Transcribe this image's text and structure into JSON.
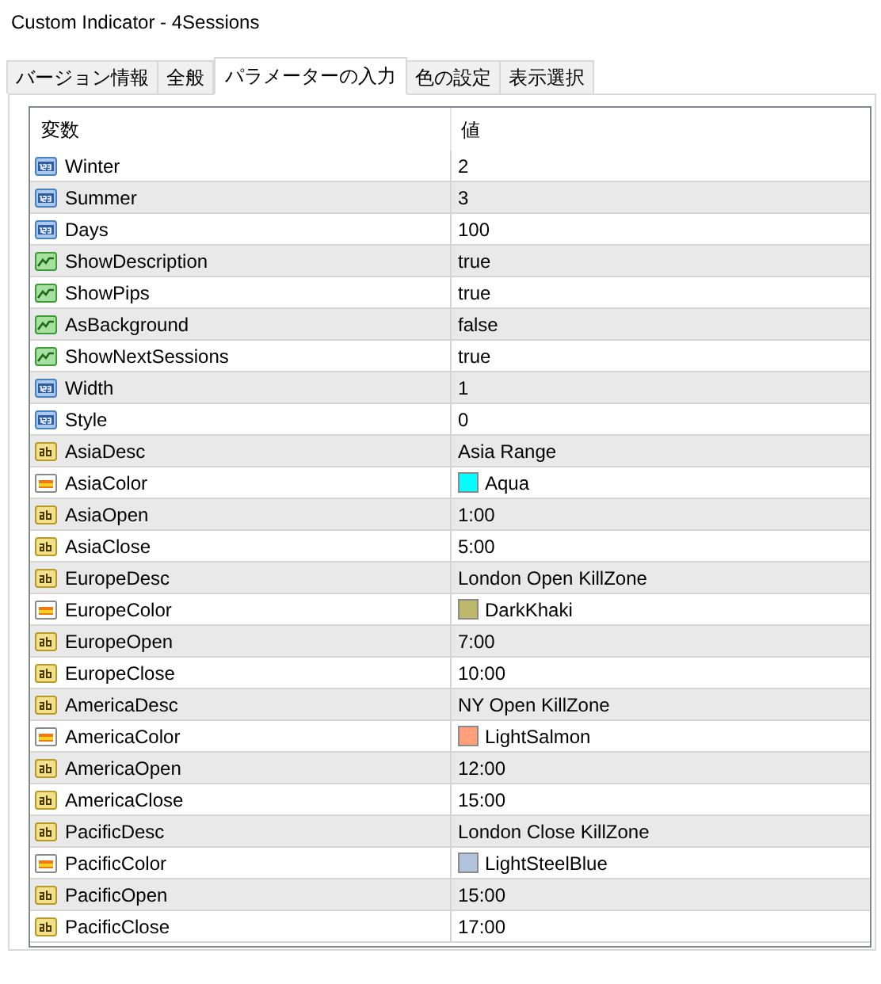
{
  "window": {
    "title": "Custom Indicator - 4Sessions"
  },
  "tabs": [
    {
      "label": "バージョン情報",
      "selected": false
    },
    {
      "label": "全般",
      "selected": false
    },
    {
      "label": "パラメーターの入力",
      "selected": true
    },
    {
      "label": "色の設定",
      "selected": false
    },
    {
      "label": "表示選択",
      "selected": false
    }
  ],
  "table": {
    "columns": [
      "変数",
      "値"
    ],
    "rows": [
      {
        "kind": "int",
        "name": "Winter",
        "value": "2"
      },
      {
        "kind": "int",
        "name": "Summer",
        "value": "3"
      },
      {
        "kind": "int",
        "name": "Days",
        "value": "100"
      },
      {
        "kind": "bool",
        "name": "ShowDescription",
        "value": "true"
      },
      {
        "kind": "bool",
        "name": "ShowPips",
        "value": "true"
      },
      {
        "kind": "bool",
        "name": "AsBackground",
        "value": "false"
      },
      {
        "kind": "bool",
        "name": "ShowNextSessions",
        "value": "true"
      },
      {
        "kind": "int",
        "name": "Width",
        "value": "1"
      },
      {
        "kind": "int",
        "name": "Style",
        "value": "0"
      },
      {
        "kind": "string",
        "name": "AsiaDesc",
        "value": "Asia Range"
      },
      {
        "kind": "color",
        "name": "AsiaColor",
        "value": "Aqua",
        "color": "#00ffff"
      },
      {
        "kind": "string",
        "name": "AsiaOpen",
        "value": "1:00"
      },
      {
        "kind": "string",
        "name": "AsiaClose",
        "value": "5:00"
      },
      {
        "kind": "string",
        "name": "EuropeDesc",
        "value": "London Open KillZone"
      },
      {
        "kind": "color",
        "name": "EuropeColor",
        "value": "DarkKhaki",
        "color": "#bdb76b"
      },
      {
        "kind": "string",
        "name": "EuropeOpen",
        "value": "7:00"
      },
      {
        "kind": "string",
        "name": "EuropeClose",
        "value": "10:00"
      },
      {
        "kind": "string",
        "name": "AmericaDesc",
        "value": "NY Open KillZone"
      },
      {
        "kind": "color",
        "name": "AmericaColor",
        "value": "LightSalmon",
        "color": "#ffa07a"
      },
      {
        "kind": "string",
        "name": "AmericaOpen",
        "value": "12:00"
      },
      {
        "kind": "string",
        "name": "AmericaClose",
        "value": "15:00"
      },
      {
        "kind": "string",
        "name": "PacificDesc",
        "value": "London Close KillZone"
      },
      {
        "kind": "color",
        "name": "PacificColor",
        "value": "LightSteelBlue",
        "color": "#b0c4de"
      },
      {
        "kind": "string",
        "name": "PacificOpen",
        "value": "15:00"
      },
      {
        "kind": "string",
        "name": "PacificClose",
        "value": "17:00"
      }
    ]
  }
}
